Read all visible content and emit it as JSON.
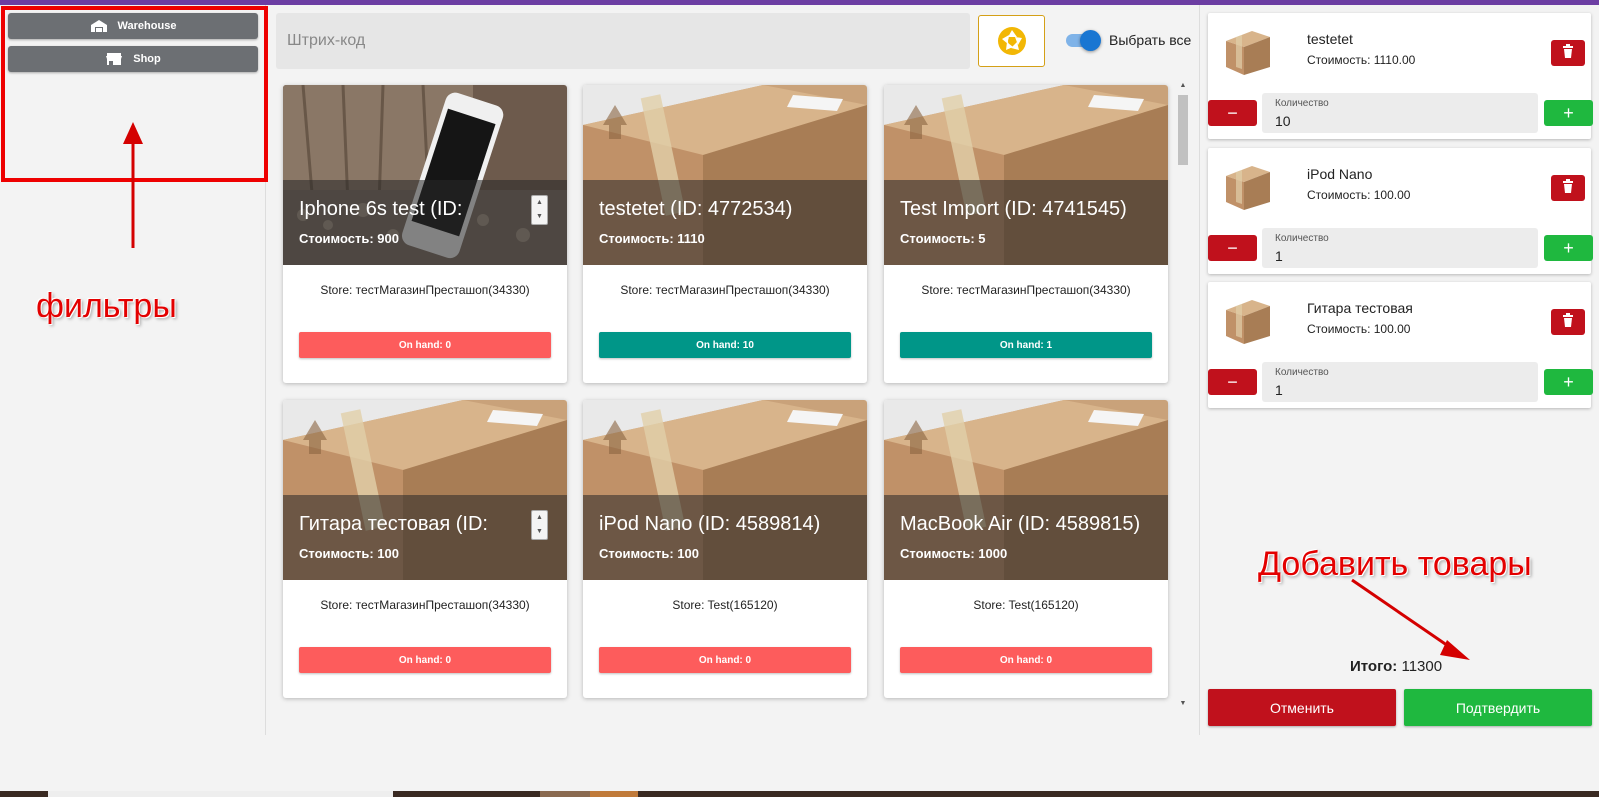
{
  "filters": {
    "warehouse_label": "Warehouse",
    "shop_label": "Shop"
  },
  "search": {
    "placeholder": "Штрих-код"
  },
  "select_all_label": "Выбрать все",
  "products": [
    {
      "title": "Iphone 6s test (ID:",
      "price": "Стоимость: 900",
      "store": "Store: тестМагазинПресташоп(34330)",
      "on_hand": "On hand: 0",
      "on_hand_color": "#fd5c5c",
      "image": "iphone"
    },
    {
      "title": "testetet (ID: 4772534)",
      "price": "Стоимость: 1110",
      "store": "Store: тестМагазинПресташоп(34330)",
      "on_hand": "On hand: 10",
      "on_hand_color": "#009688",
      "image": "box"
    },
    {
      "title": "Test Import (ID: 4741545)",
      "price": "Стоимость: 5",
      "store": "Store: тестМагазинПресташоп(34330)",
      "on_hand": "On hand: 1",
      "on_hand_color": "#009688",
      "image": "box"
    },
    {
      "title": "Гитара тестовая (ID:",
      "price": "Стоимость: 100",
      "store": "Store: тестМагазинПресташоп(34330)",
      "on_hand": "On hand: 0",
      "on_hand_color": "#fd5c5c",
      "image": "box"
    },
    {
      "title": "iPod Nano (ID: 4589814)",
      "price": "Стоимость: 100",
      "store": "Store: Test(165120)",
      "on_hand": "On hand: 0",
      "on_hand_color": "#fd5c5c",
      "image": "box"
    },
    {
      "title": "MacBook Air (ID: 4589815)",
      "price": "Стоимость: 1000",
      "store": "Store: Test(165120)",
      "on_hand": "On hand: 0",
      "on_hand_color": "#fd5c5c",
      "image": "box"
    }
  ],
  "cart": {
    "quantity_label": "Количество",
    "items": [
      {
        "name": "testetet",
        "price": "Стоимость: 1110.00",
        "quantity": "10"
      },
      {
        "name": "iPod Nano",
        "price": "Стоимость: 100.00",
        "quantity": "1"
      },
      {
        "name": "Гитара тестовая",
        "price": "Стоимость: 100.00",
        "quantity": "1"
      }
    ],
    "total_label": "Итого:",
    "total_value": "11300",
    "cancel_label": "Отменить",
    "confirm_label": "Подтвердить"
  },
  "annotations": {
    "filters": "фильтры",
    "add_products": "Добавить товары"
  },
  "colors": {
    "accent_top": "#6c3ea3",
    "danger": "#c0111c",
    "success": "#1fb83f",
    "teal": "#009688",
    "annotation_red": "#e30000",
    "filter_button": "#6c6f73"
  }
}
